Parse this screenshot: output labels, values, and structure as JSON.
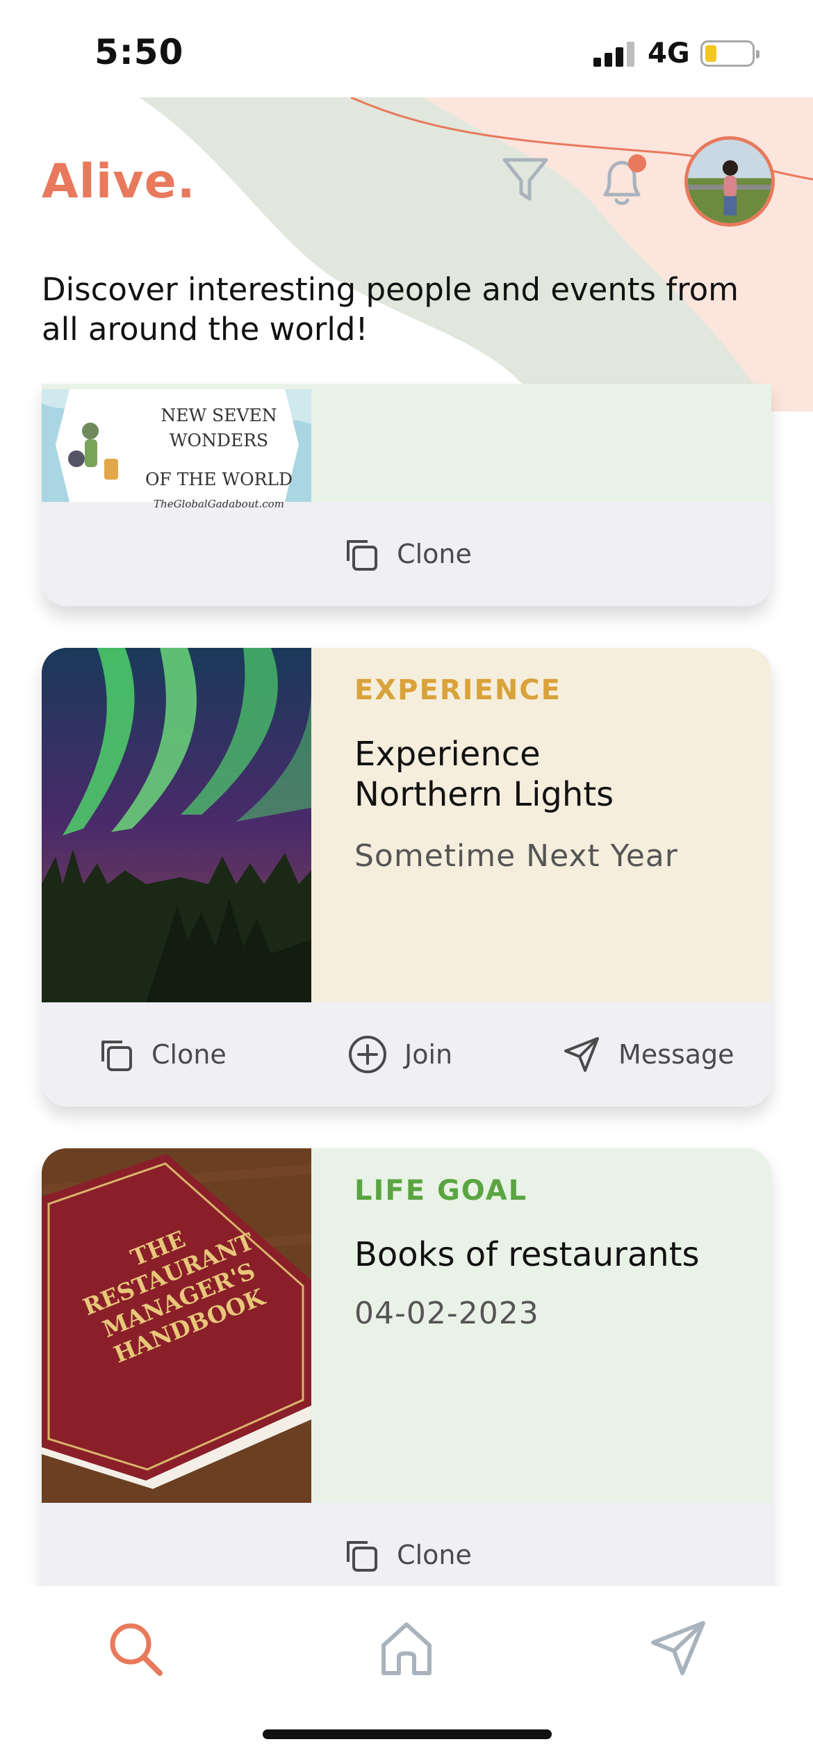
{
  "status_bar": {
    "time": "5:50",
    "network": "4G"
  },
  "header": {
    "app_title": "Alive.",
    "tagline": "Discover interesting people and events from all around the world!"
  },
  "cards": [
    {
      "image_lines": [
        "NEW SEVEN WONDERS",
        "OF THE WORLD",
        "TheGlobalGadabout.com"
      ],
      "actions": [
        "Clone"
      ]
    },
    {
      "category": "EXPERIENCE",
      "title_line1": "Experience",
      "title_line2": "Northern Lights",
      "subtitle": "Sometime Next Year",
      "actions": [
        "Clone",
        "Join",
        "Message"
      ]
    },
    {
      "category": "LIFE GOAL",
      "title": "Books of restaurants",
      "subtitle": "04-02-2023",
      "image_lines": [
        "THE",
        "RESTAURANT",
        "MANAGER'S",
        "HANDBOOK"
      ],
      "actions": [
        "Clone"
      ]
    }
  ],
  "colors": {
    "accent": "#e8795c",
    "experience": "#d9a23a",
    "life_goal": "#5aa542",
    "experience_bg": "#f5eedd",
    "life_goal_bg": "#e9f2e6"
  },
  "nav": [
    "search-icon",
    "home-icon",
    "send-icon"
  ]
}
